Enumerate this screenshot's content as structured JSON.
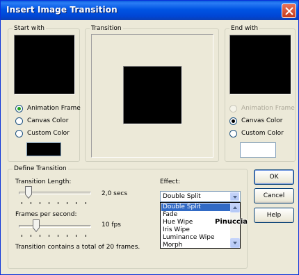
{
  "window": {
    "title": "Insert Image Transition"
  },
  "start_with": {
    "legend": "Start with",
    "options": [
      "Animation Frame",
      "Canvas Color",
      "Custom Color"
    ],
    "selected": "Animation Frame",
    "custom_color": "#000000",
    "preview_color": "#000000"
  },
  "transition": {
    "legend": "Transition",
    "preview_color": "#000000"
  },
  "end_with": {
    "legend": "End with",
    "options": [
      "Animation Frame",
      "Canvas Color",
      "Custom Color"
    ],
    "selected": "Canvas Color",
    "disabled": [
      "Animation Frame"
    ],
    "custom_color": "#ffffff",
    "preview_color": "#000000"
  },
  "define_transition": {
    "legend": "Define Transition",
    "length_label": "Transition Length:",
    "length_value": "2,0 secs",
    "fps_label": "Frames per second:",
    "fps_value": "10 fps",
    "summary": "Transition contains a total of 20 frames.",
    "effect_label": "Effect:",
    "effect_selected": "Double Split",
    "effect_options": [
      "Double Split",
      "Fade",
      "Hue Wipe",
      "Iris Wipe",
      "Luminance Wipe",
      "Morph"
    ]
  },
  "buttons": {
    "ok": "OK",
    "cancel": "Cancel",
    "help": "Help"
  },
  "watermark": "Pinuccia",
  "colors": {
    "title_bar": "#0054e3",
    "selection": "#316ac5",
    "dialog_bg": "#ece9d8"
  }
}
